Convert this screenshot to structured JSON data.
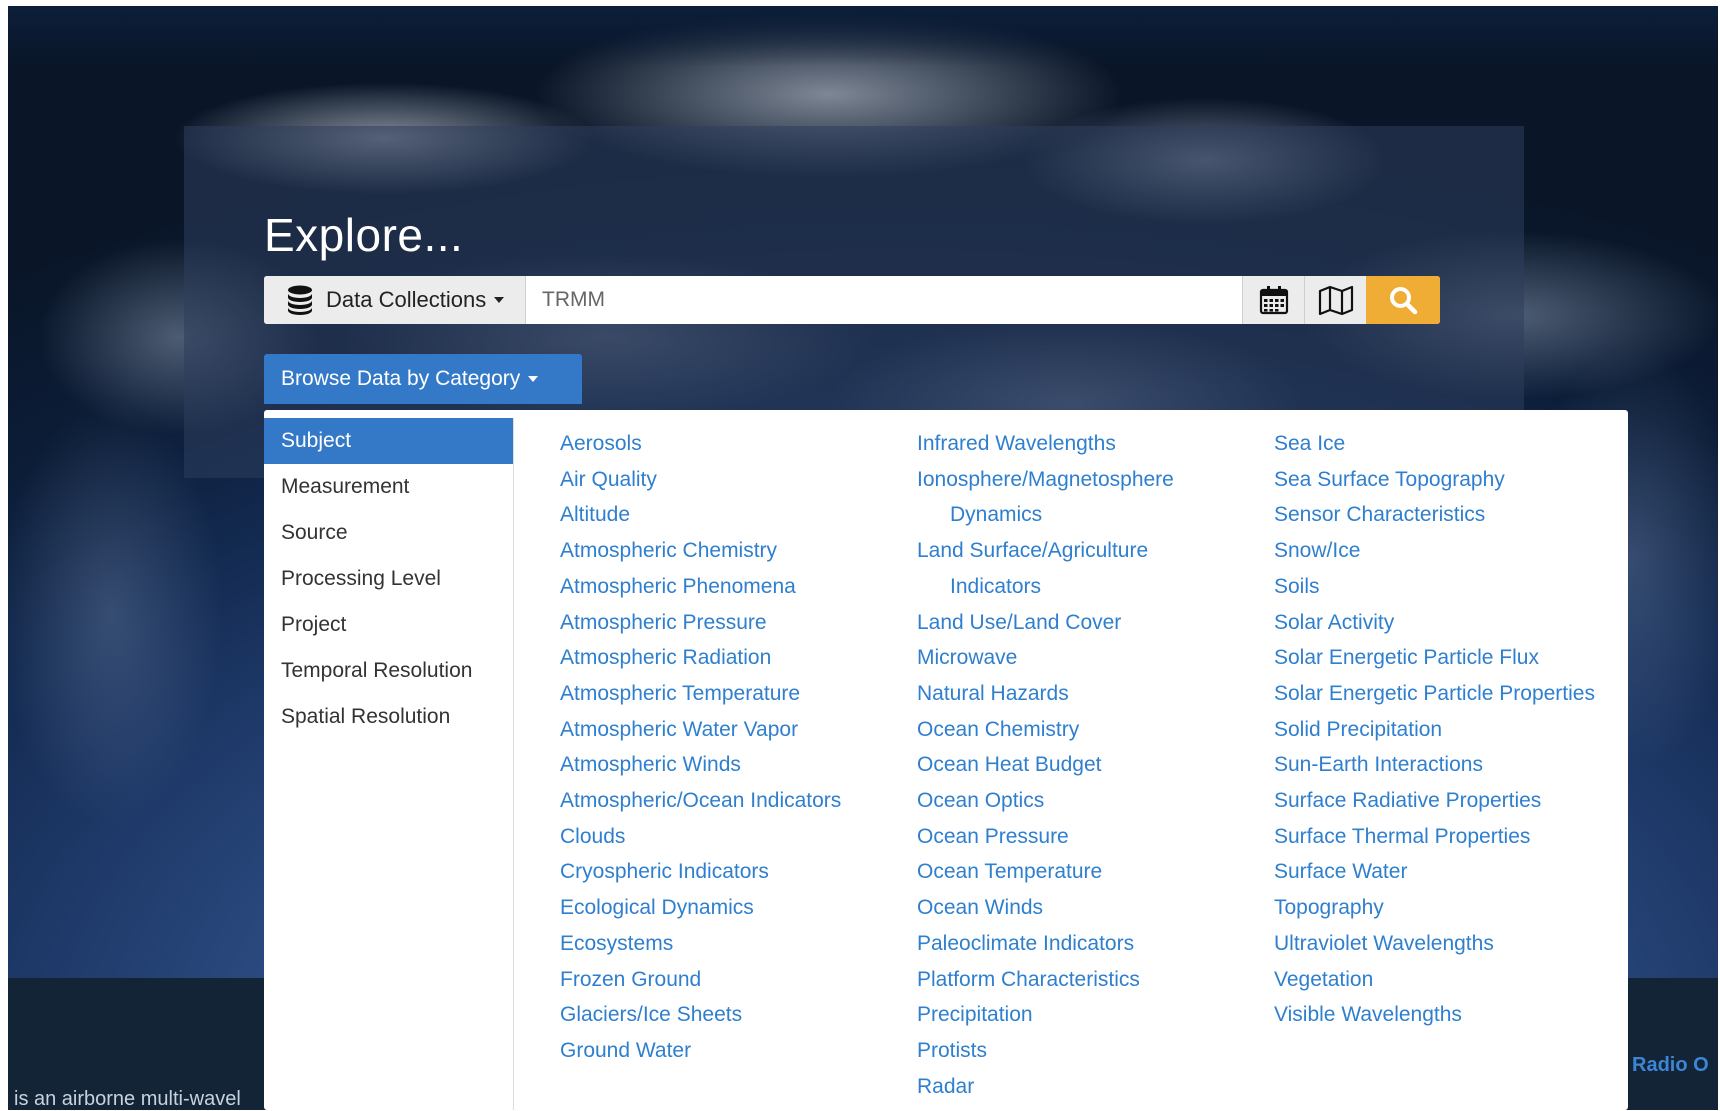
{
  "hero": {
    "title": "Explore..."
  },
  "search": {
    "collection_label": "Data Collections",
    "query_value": "TRMM",
    "calendar_icon": "calendar-icon",
    "map_icon": "map-icon",
    "search_icon": "search-icon",
    "database_icon": "database-icon",
    "accent_color": "#f0ad35"
  },
  "browse": {
    "button_label": "Browse Data by Category",
    "accent_color": "#3479c7"
  },
  "categories": [
    {
      "label": "Subject",
      "active": true
    },
    {
      "label": "Measurement",
      "active": false
    },
    {
      "label": "Source",
      "active": false
    },
    {
      "label": "Processing Level",
      "active": false
    },
    {
      "label": "Project",
      "active": false
    },
    {
      "label": "Temporal Resolution",
      "active": false
    },
    {
      "label": "Spatial Resolution",
      "active": false
    }
  ],
  "subjects": {
    "col1": [
      "Aerosols",
      "Air Quality",
      "Altitude",
      "Atmospheric Chemistry",
      "Atmospheric Phenomena",
      "Atmospheric Pressure",
      "Atmospheric Radiation",
      "Atmospheric Temperature",
      "Atmospheric Water Vapor",
      "Atmospheric Winds",
      "Atmospheric/Ocean Indicators",
      "Clouds",
      "Cryospheric Indicators",
      "Ecological Dynamics",
      "Ecosystems",
      "Frozen Ground",
      "Glaciers/Ice Sheets",
      "Ground Water"
    ],
    "col2": [
      "Infrared Wavelengths",
      "Ionosphere/Magnetosphere Dynamics",
      "Land Surface/Agriculture Indicators",
      "Land Use/Land Cover",
      "Microwave",
      "Natural Hazards",
      "Ocean Chemistry",
      "Ocean Heat Budget",
      "Ocean Optics",
      "Ocean Pressure",
      "Ocean Temperature",
      "Ocean Winds",
      "Paleoclimate Indicators",
      "Platform Characteristics",
      "Precipitation",
      "Protists",
      "Radar"
    ],
    "col3": [
      "Sea Ice",
      "Sea Surface Topography",
      "Sensor Characteristics",
      "Snow/Ice",
      "Soils",
      "Solar Activity",
      "Solar Energetic Particle Flux",
      "Solar Energetic Particle Properties",
      "Solid Precipitation",
      "Sun-Earth Interactions",
      "Surface Radiative Properties",
      "Surface Thermal Properties",
      "Surface Water",
      "Topography",
      "Ultraviolet Wavelengths",
      "Vegetation",
      "Visible Wavelengths"
    ]
  },
  "footer": {
    "left_text": "is an airborne multi-wavel",
    "right_text": "Radio O"
  },
  "link_color": "#2f7fcf"
}
